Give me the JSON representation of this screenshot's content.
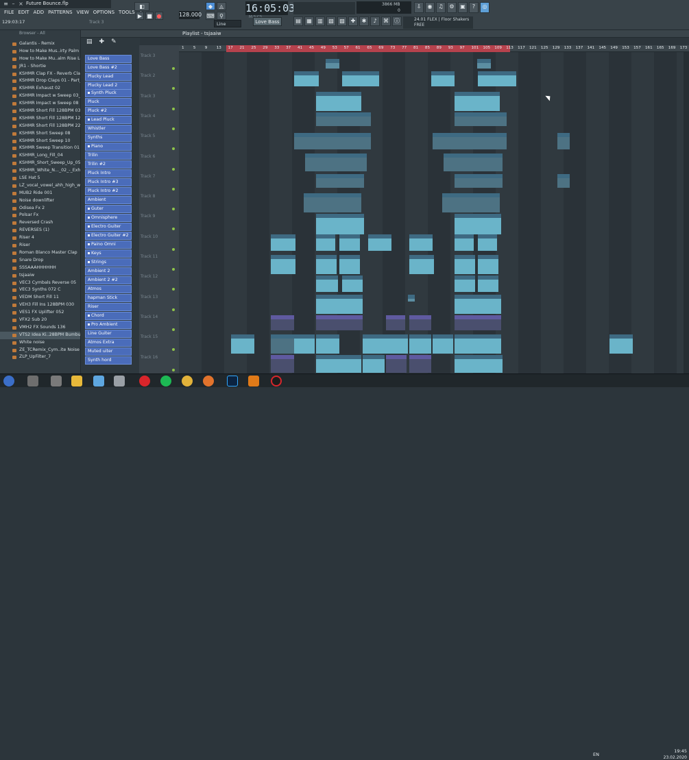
{
  "window": {
    "filename": "Future Bounce.flp"
  },
  "menu": [
    "FILE",
    "EDIT",
    "ADD",
    "PATTERNS",
    "VIEW",
    "OPTIONS",
    "TOOLS",
    "?"
  ],
  "hint": "129:03:17",
  "track_label": "Track 3",
  "transport": {
    "time": "16:05:03",
    "time_sub": "M:S:CS",
    "tempo": "128.000",
    "line_mode": "Line",
    "pattern": "Love Bass"
  },
  "cpu": {
    "mem": "3866 MB",
    "voices": "0"
  },
  "news": {
    "line1": "24.01  FLEX | Floor Shakers",
    "line2": "FREE"
  },
  "browser": {
    "header": "Browser - All",
    "items": [
      "Galantis - Remix",
      "How to Make Mus..irty Palm bass",
      "How to Make Mu..alm Rise Lead",
      "JR1 - Shortie",
      "KSHMR Clap FX - Reverb Clap 01",
      "KSHMR Drop Claps 01 - Part_1",
      "KSHMR Exhaust 02",
      "KSHMR Impact w Sweep 03_3",
      "KSHMR Impact w Sweep 08",
      "KSHMR Short Fill 128BPM 03",
      "KSHMR Short Fill 128BPM 12",
      "KSHMR Short Fill 128BPM 22",
      "KSHMR Short Sweep 08",
      "KSHMR Short Sweep 10",
      "KSHMR Sweep Transition 01",
      "KSHMR_Long_Fill_04",
      "KSHMR_Short_Sweep_Up_05",
      "KSHMR_White_N..._02_-_Exhaust",
      "LSE Hat 5",
      "LZ_vocal_vowel_ahh_high_wet_C",
      "MUB2 Ride 001",
      "Noise downlifter",
      "Odisea Fx 2",
      "Polsar Fx",
      "Reversed Crash",
      "REVERSES (1)",
      "Riser 4",
      "Riser",
      "Roman Blanco Master Clap",
      "Snare Drop",
      "SSSAAAHHHHHH",
      "tsjaaiw",
      "VEC3 Cymbals Reverse 05",
      "VEC3 Synths 072 C",
      "VEDM Short Fill 11",
      "VEH3 Fill Ins 128BPM 030",
      "VES1 FX Uplifter 052",
      "VFX2 Sub 20",
      "VMH2 FX Sounds 136",
      "VTS2 Idea Ki..28BPM Bumbum",
      "White noise",
      "ZE_TCRemix_Cym..ite Noise Ride",
      "ZLP_UpFilter_7"
    ]
  },
  "playlist": {
    "title": "Playlist - tsjaaiw"
  },
  "channels": [
    "Love Bass",
    "Love Bass #2",
    "Plucky Lead",
    "Plucky Lead 2",
    "Synth Pluck",
    "Pluck",
    "Pluck #2",
    "Lead Pluck",
    "Whistler",
    "Synths",
    "Piano",
    "Trilin",
    "Trilin #2",
    "Pluck Intro",
    "Pluck Intro #3",
    "Pluck Intro #2",
    "Ambient",
    "Guter",
    "Omnisphere",
    "Electro Guiter",
    "Electro Guiter #2",
    "Paino Omni",
    "Keys",
    "Strings",
    "Ambient 2",
    "Ambient 2 #2",
    "Atmos",
    "hapman Stick",
    "Riser",
    "Chord",
    "Pro Ambient",
    "Line Guiter",
    "Atmos Extra",
    "Muted uiter",
    "Synth hord"
  ],
  "tracks": [
    "Track 3",
    "Track 2",
    "Track 3",
    "Track 4",
    "Track 5",
    "Track 6",
    "Track 7",
    "Track 8",
    "Track 9",
    "Track 10",
    "Track 11",
    "Track 12",
    "Track 13",
    "Track 14",
    "Track 15",
    "Track 16"
  ],
  "ruler": [
    "1",
    "5",
    "9",
    "13",
    "17",
    "21",
    "25",
    "29",
    "33",
    "37",
    "41",
    "45",
    "49",
    "53",
    "57",
    "61",
    "65",
    "69",
    "73",
    "77",
    "81",
    "85",
    "89",
    "93",
    "97",
    "101",
    "105",
    "109",
    "113",
    "117",
    "121",
    "125",
    "129",
    "133",
    "137",
    "141",
    "145",
    "149",
    "153",
    "157",
    "161",
    "165",
    "169",
    "173"
  ],
  "clip_labels": {
    "manse": "Manse Riser",
    "manse2": "Manse Riser #2",
    "manse3": "Manse Riser",
    "manse4": "er #2",
    "vve": "VVE2_BPM",
    "vve2": "VVE2_BPM",
    "rev": "Rev..no",
    "deli": "Deli..Mer 3",
    "deli2": "Deli..Mer 3",
    "fx01": "FX_01",
    "fx01b": "FX_01",
    "dow": "Dow..X 04",
    "dow2": "Dow..X 04",
    "dowfx": "Dow..FX",
    "dowfx2": "Dow..FX",
    "upli": "Upli..2",
    "huge": "Huge_1_2",
    "huge2": "Huge_1_2",
    "amazi": "Amazi..hor",
    "delif": "Delif..3 #2"
  },
  "taskbar": {
    "lang": "EN",
    "time": "19:45",
    "date": "23.02.2020"
  },
  "colors": {
    "accent": "#4a6cba",
    "ruler_red": "#b6424d",
    "clip": "#5c8ea2"
  }
}
